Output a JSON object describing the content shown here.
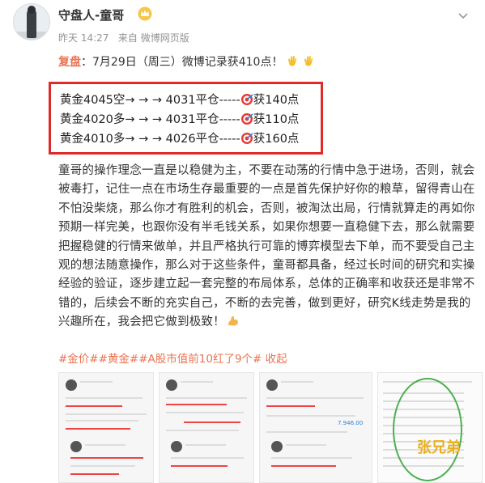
{
  "header": {
    "username": "守盘人-童哥",
    "time": "昨天 14:27",
    "source": "来自 微博网页版"
  },
  "post": {
    "lead_label": "复盘",
    "lead_text": "：7月29日（周三）微博记录获410点！",
    "trades": [
      {
        "text": "黄金4045空→ → → 4031平仓-----",
        "result": "获140点"
      },
      {
        "text": "黄金4020多→ → → 4031平仓-----",
        "result": "获110点"
      },
      {
        "text": "黄金4010多→ → → 4026平仓-----",
        "result": "获160点"
      }
    ],
    "body": "童哥的操作理念一直是以稳健为主，不要在动荡的行情中急于进场，否则，就会被毒打，记住一点在市场生存最重要的一点是首先保护好你的粮草，留得青山在不怕没柴烧，那么你才有胜利的机会，否则，被淘汰出局，行情就算走的再如你预期一样完美，也跟你没有半毛钱关系，如果你想要一直稳健下去，那么就需要把握稳健的行情来做单，并且严格执行可靠的博弈模型去下单，而不要受自己主观的想法随意操作，那么对于这些条件，童哥都具备，经过长时间的研究和实操经验的验证，逐步建立起一套完整的布局体系，总体的正确率和收获还是非常不错的，后续会不断的充实自己，不断的去完善，做到更好，研究K线走势是我的兴趣所在，我会把它做到极致！"
  },
  "tags": {
    "text": "#金价##黄金##A股市值前10红了9个#",
    "collapse": "收起"
  },
  "thumbnails": {
    "t4_name": "张兄弟",
    "t3_value": "7.946.00"
  },
  "colors": {
    "accent": "#eb7350",
    "box_border": "#e02a2a"
  }
}
